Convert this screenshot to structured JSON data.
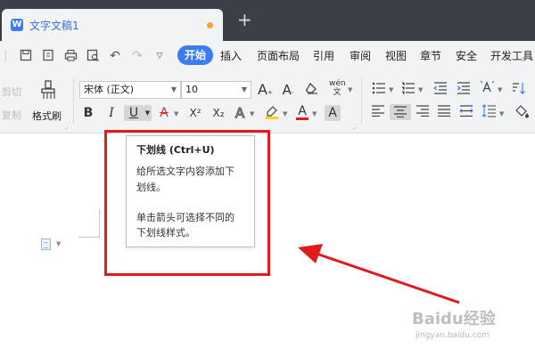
{
  "titlebar": {
    "tab_title": "文字文稿1",
    "new_tab_symbol": "+"
  },
  "menu": {
    "items": [
      "开始",
      "插入",
      "页面布局",
      "引用",
      "审阅",
      "视图",
      "章节",
      "安全",
      "开发工具"
    ],
    "active_index": 0
  },
  "ribbon": {
    "cut_label": "剪切",
    "copy_label": "复制",
    "format_painter_label": "格式刷",
    "font_name": "宋体 (正文)",
    "font_size": "10",
    "pinyin_label": "wén",
    "bold_label": "B",
    "italic_label": "I",
    "underline_label": "U",
    "strike_label": "A",
    "superscript_label": "X²",
    "subscript_label": "X₂",
    "text_effect_label": "A",
    "font_color_label": "A",
    "char_shading_label": "A",
    "grow_font_label": "A",
    "shrink_font_label": "A"
  },
  "tooltip": {
    "title": "下划线 (Ctrl+U)",
    "desc_line1": "给所选文字内容添加下",
    "desc_line2": "划线。",
    "desc_line3": "单击箭头可选择不同的",
    "desc_line4": "下划线样式。"
  },
  "watermark": {
    "text": "Baidu经验",
    "url": "jingyan.baidu.com"
  },
  "colors": {
    "accent": "#3d7bf2",
    "annotation_red": "#e11b1b",
    "titlebar_bg": "#3c3f45"
  }
}
